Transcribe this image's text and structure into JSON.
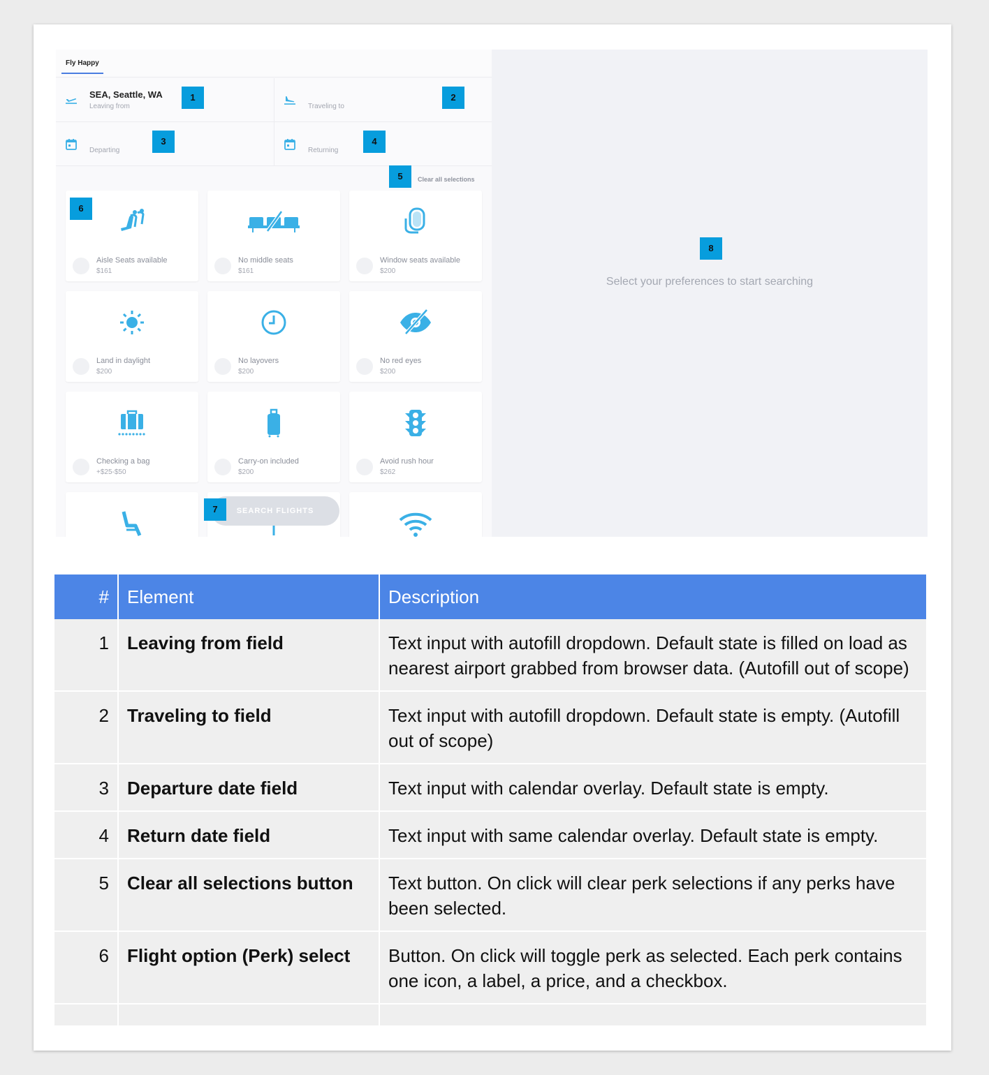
{
  "app": {
    "tab_label": "Fly Happy"
  },
  "fields": {
    "leaving": {
      "value": "SEA, Seattle, WA",
      "label": "Leaving from",
      "icon": "plane-departure-icon"
    },
    "traveling": {
      "label": "Traveling to",
      "icon": "plane-arrival-icon"
    },
    "departing": {
      "label": "Departing",
      "icon": "calendar-icon"
    },
    "returning": {
      "label": "Returning",
      "icon": "calendar-icon"
    }
  },
  "clear_label": "Clear all selections",
  "perks": [
    {
      "label": "Aisle Seats available",
      "price": "$161",
      "icon": "aisle-seat-icon"
    },
    {
      "label": "No middle seats",
      "price": "$161",
      "icon": "no-middle-seat-icon"
    },
    {
      "label": "Window seats available",
      "price": "$200",
      "icon": "window-seat-icon"
    },
    {
      "label": "Land in daylight",
      "price": "$200",
      "icon": "sun-icon"
    },
    {
      "label": "No layovers",
      "price": "$200",
      "icon": "clock-icon"
    },
    {
      "label": "No red eyes",
      "price": "$200",
      "icon": "eye-slash-icon"
    },
    {
      "label": "Checking a bag",
      "price": "+$25-$50",
      "icon": "checked-bag-icon"
    },
    {
      "label": "Carry-on included",
      "price": "$200",
      "icon": "carry-on-icon"
    },
    {
      "label": "Avoid rush hour",
      "price": "$262",
      "icon": "traffic-light-icon"
    },
    {
      "label": "",
      "price": "",
      "icon": "reclining-seat-icon"
    },
    {
      "label": "",
      "price": "",
      "icon": "drink-icon"
    },
    {
      "label": "",
      "price": "",
      "icon": "wifi-icon"
    }
  ],
  "search_label": "SEARCH FLIGHTS",
  "empty_message": "Select your preferences to start searching",
  "badges": [
    "1",
    "2",
    "3",
    "4",
    "5",
    "6",
    "7",
    "8"
  ],
  "colors": {
    "badge": "#079ddd",
    "accent": "#3ab0e6",
    "table_header": "#4c85e6"
  },
  "table": {
    "headers": [
      "#",
      "Element",
      "Description"
    ],
    "rows": [
      {
        "num": "1",
        "element": "Leaving from field",
        "description": "Text input with autofill dropdown. Default state is filled on load as nearest airport grabbed from browser data. (Autofill out of scope)"
      },
      {
        "num": "2",
        "element": "Traveling to field",
        "description": "Text input with autofill dropdown. Default state is empty. (Autofill out of scope)"
      },
      {
        "num": "3",
        "element": "Departure date field",
        "description": "Text input with calendar overlay. Default state is empty."
      },
      {
        "num": "4",
        "element": "Return date field",
        "description": "Text input with same calendar overlay. Default state is empty."
      },
      {
        "num": "5",
        "element": "Clear all selections button",
        "description": "Text button. On click will clear perk selections if any perks have been selected."
      },
      {
        "num": "6",
        "element": "Flight option (Perk) select",
        "description": "Button. On click will toggle perk as selected. Each perk contains one icon, a label, a price, and a checkbox."
      }
    ]
  }
}
